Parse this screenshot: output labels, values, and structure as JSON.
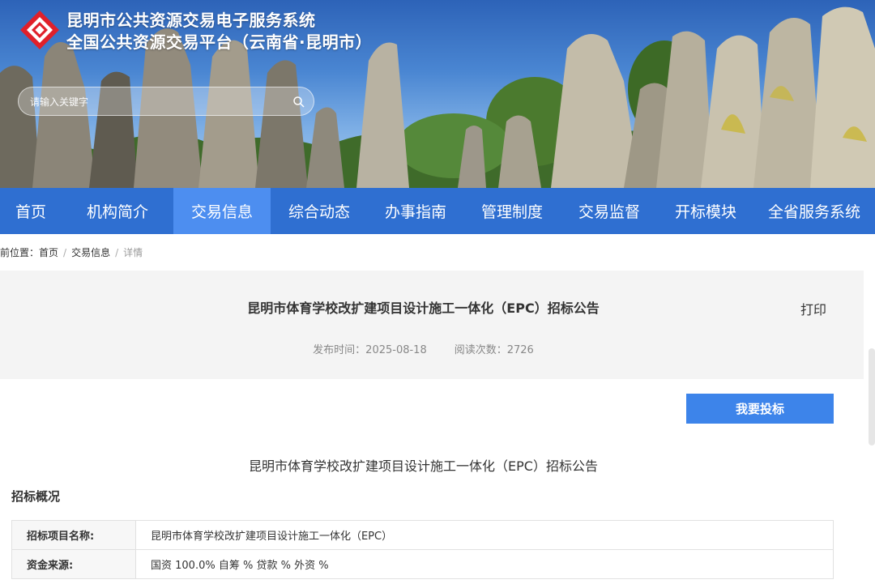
{
  "site": {
    "title_line1": "昆明市公共资源交易电子服务系统",
    "title_line2": "全国公共资源交易平台（云南省·昆明市）"
  },
  "search": {
    "placeholder": "请输入关键字"
  },
  "nav": {
    "items": [
      {
        "label": "首页",
        "active": false
      },
      {
        "label": "机构简介",
        "active": false
      },
      {
        "label": "交易信息",
        "active": true
      },
      {
        "label": "综合动态",
        "active": false
      },
      {
        "label": "办事指南",
        "active": false
      },
      {
        "label": "管理制度",
        "active": false
      },
      {
        "label": "交易监督",
        "active": false
      },
      {
        "label": "开标模块",
        "active": false
      },
      {
        "label": "全省服务系统",
        "active": false
      }
    ]
  },
  "breadcrumb": {
    "prefix": "前位置：",
    "items": [
      "首页",
      "交易信息"
    ],
    "separator": "/",
    "current": "详情"
  },
  "article": {
    "title": "昆明市体育学校改扩建项目设计施工一体化（EPC）招标公告",
    "print_label": "打印",
    "publish_label": "发布时间：2025-08-18",
    "views_label": "阅读次数：2726",
    "bid_button": "我要投标",
    "subtitle": "昆明市体育学校改扩建项目设计施工一体化（EPC）招标公告",
    "section_title": "招标概况",
    "rows": [
      {
        "key": "招标项目名称:",
        "value": "昆明市体育学校改扩建项目设计施工一体化（EPC）"
      },
      {
        "key": "资金来源:",
        "value": "国资 100.0% 自筹 % 贷款 % 外资 %"
      }
    ]
  },
  "colors": {
    "nav_bg": "#2f6fd1",
    "nav_active": "#4d8ef0",
    "button": "#3d84ea",
    "logo_red": "#e0202a"
  }
}
